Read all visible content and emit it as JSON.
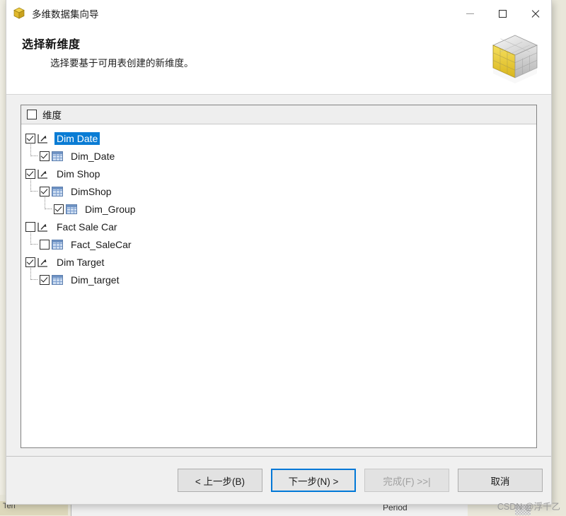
{
  "window": {
    "title": "多维数据集向导",
    "app_icon": "cube-icon",
    "controls": {
      "minimize": "minimize-icon",
      "maximize": "maximize-icon",
      "close": "close-icon"
    }
  },
  "header": {
    "title": "选择新维度",
    "subtitle": "选择要基于可用表创建的新维度。",
    "banner_icon": "cube-icon"
  },
  "list": {
    "header_label": "维度",
    "header_checked": false,
    "nodes": [
      {
        "label": "Dim Date",
        "level": 0,
        "checked": true,
        "icon": "dimension-icon",
        "selected": true
      },
      {
        "label": "Dim_Date",
        "level": 1,
        "checked": true,
        "icon": "table-icon",
        "selected": false
      },
      {
        "label": "Dim Shop",
        "level": 0,
        "checked": true,
        "icon": "dimension-icon",
        "selected": false
      },
      {
        "label": "DimShop",
        "level": 1,
        "checked": true,
        "icon": "table-icon",
        "selected": false
      },
      {
        "label": "Dim_Group",
        "level": 2,
        "checked": true,
        "icon": "table-icon",
        "selected": false
      },
      {
        "label": "Fact Sale Car",
        "level": 0,
        "checked": false,
        "icon": "dimension-icon",
        "selected": false
      },
      {
        "label": "Fact_SaleCar",
        "level": 1,
        "checked": false,
        "icon": "table-icon",
        "selected": false
      },
      {
        "label": "Dim Target",
        "level": 0,
        "checked": true,
        "icon": "dimension-icon",
        "selected": false
      },
      {
        "label": "Dim_target",
        "level": 1,
        "checked": true,
        "icon": "table-icon",
        "selected": false
      }
    ]
  },
  "footer": {
    "back_label": "< 上一步(B)",
    "back_accel": "B",
    "next_label": "下一步(N) >",
    "next_accel": "N",
    "finish_label": "完成(F) >>|",
    "finish_accel": "F",
    "finish_disabled": true,
    "cancel_label": "取消"
  },
  "background": {
    "partial_label": "Period",
    "left_label": "Ten"
  },
  "watermark": {
    "text": "CSDN @浮千乙"
  },
  "colors": {
    "selection_blue": "#0a7cd4",
    "focus_blue": "#0078d7",
    "window_bg": "#f0f0f0",
    "desktop_bg": "#e9e7da"
  }
}
